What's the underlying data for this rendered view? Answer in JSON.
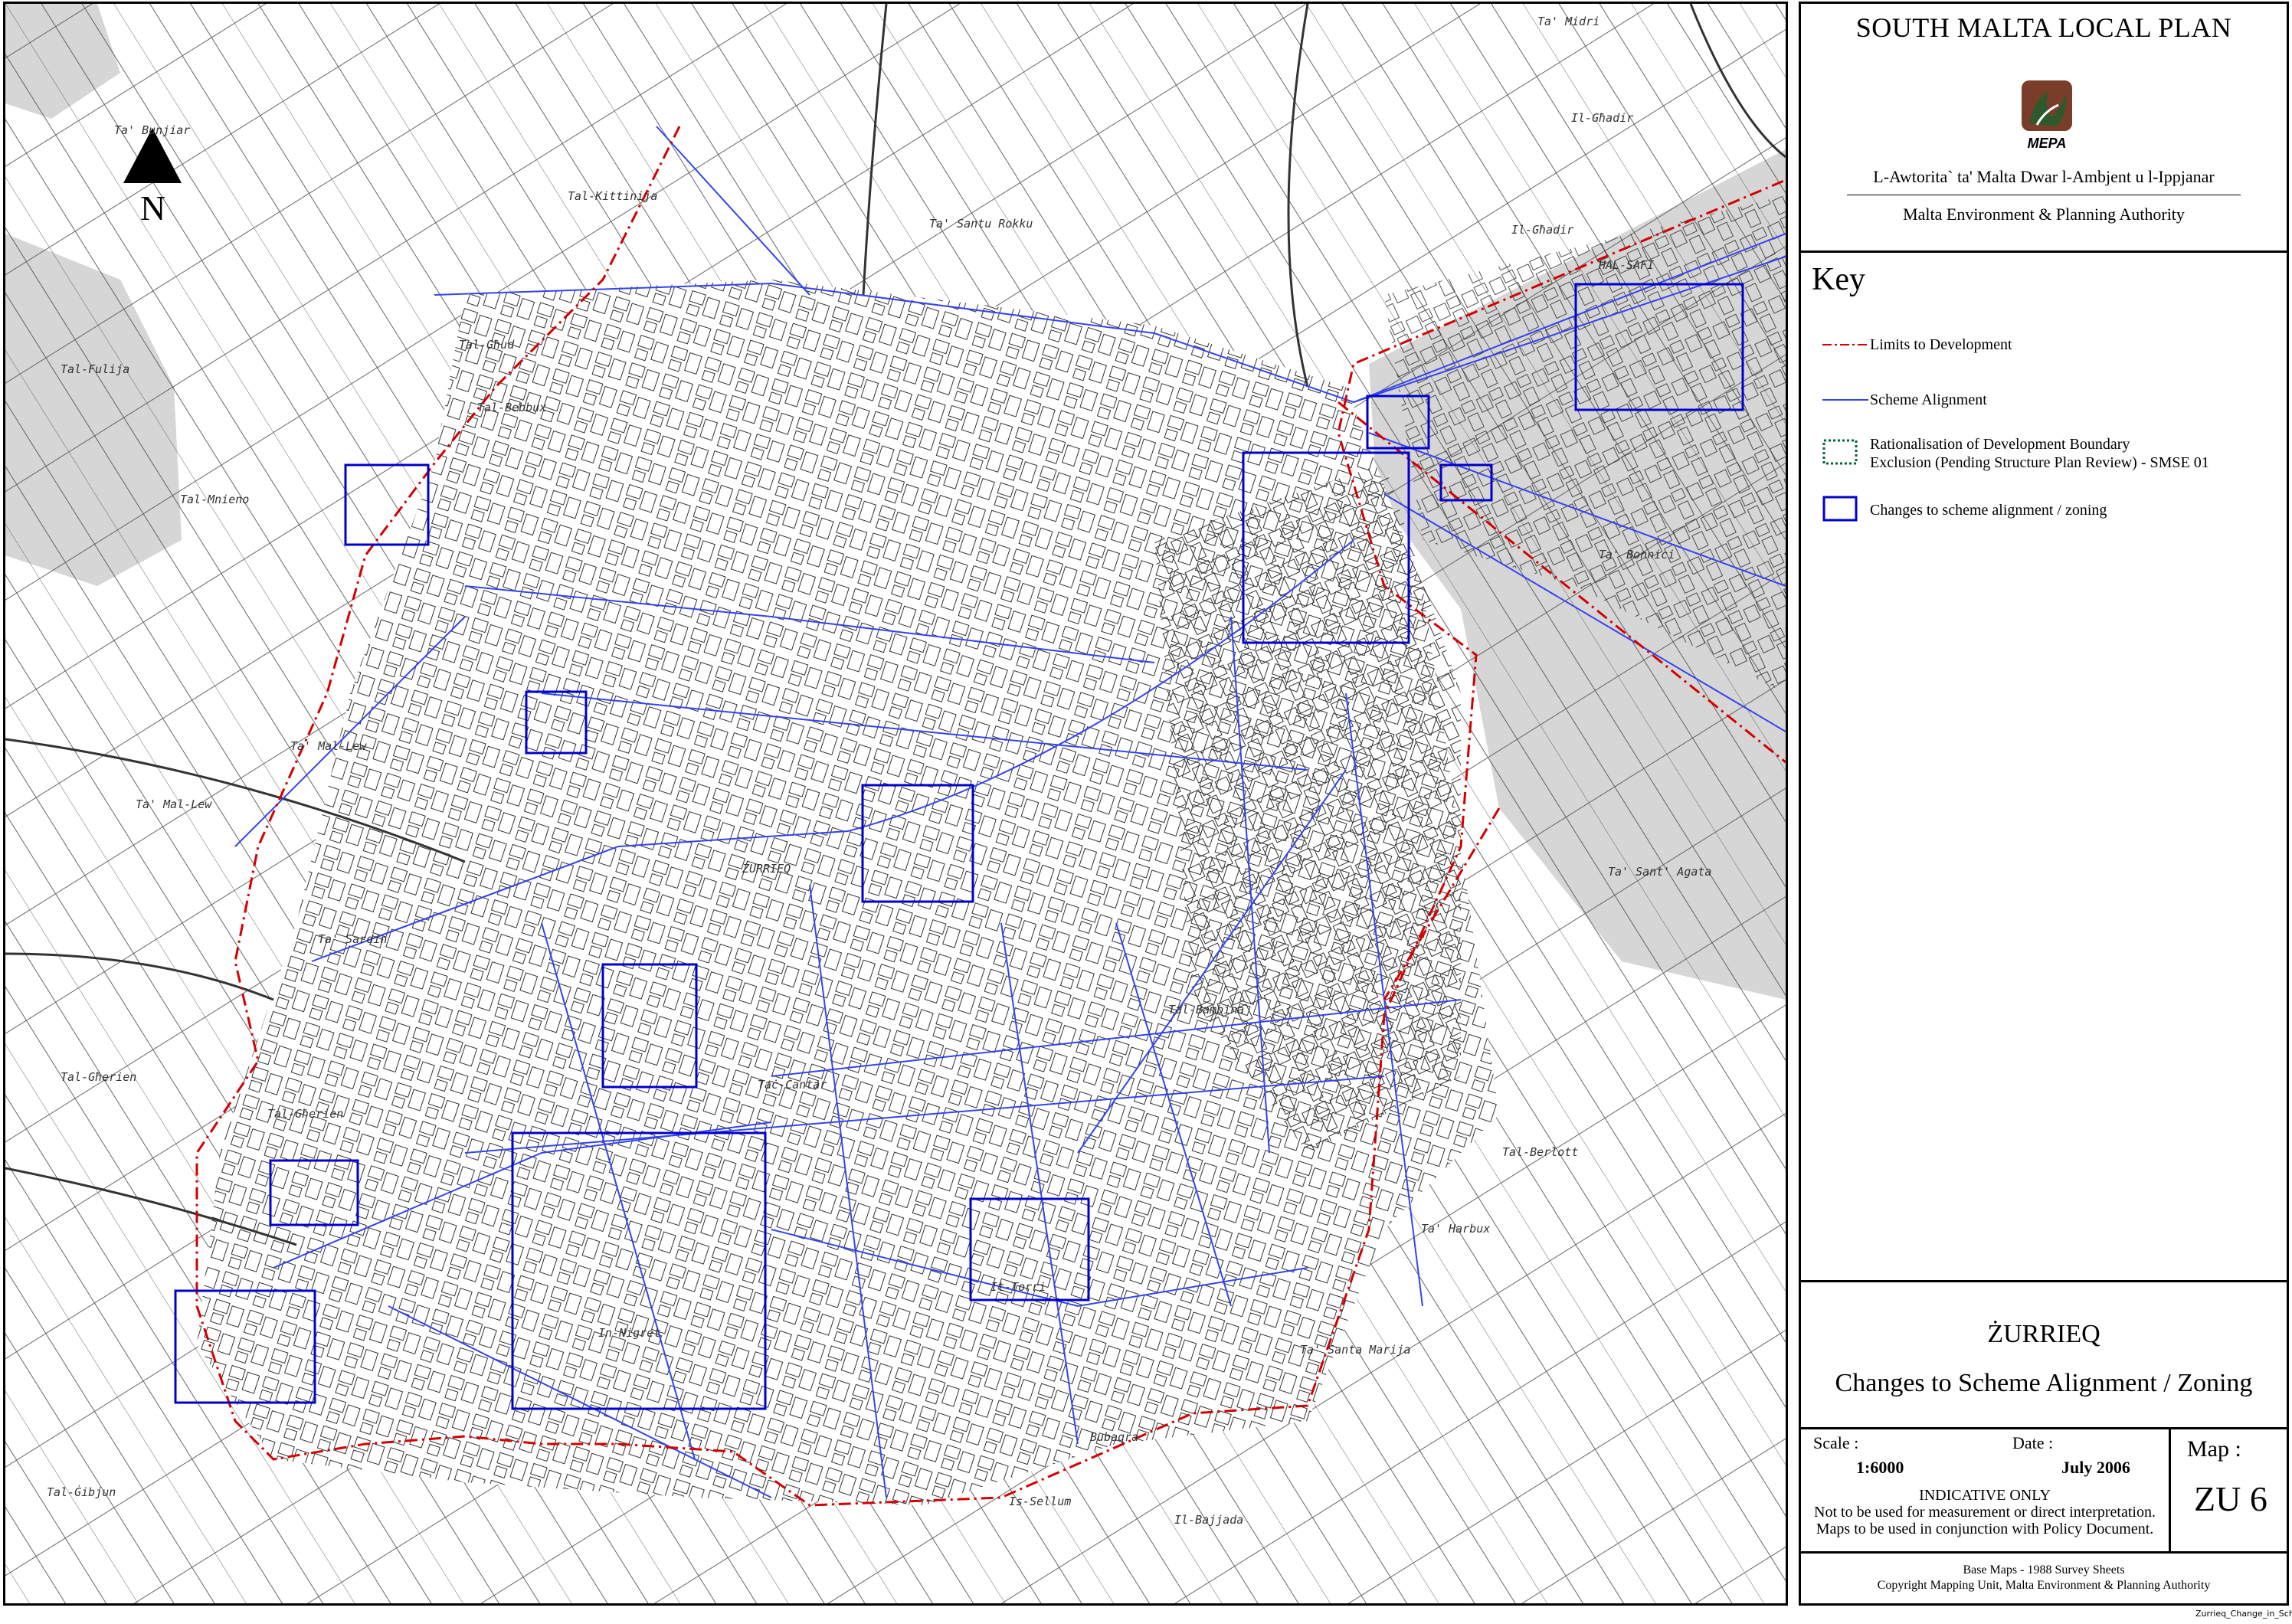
{
  "header": {
    "title": "SOUTH MALTA LOCAL PLAN",
    "logo_text": "MEPA",
    "authority_mt": "L-Awtorita` ta' Malta Dwar l-Ambjent u l-Ippjanar",
    "authority_en": "Malta Environment & Planning Authority"
  },
  "key": {
    "title": "Key",
    "items": [
      {
        "label": "Limits to Development",
        "color": "#d40000",
        "icon": "dash-dot-line"
      },
      {
        "label": "Scheme Alignment",
        "color": "#3344ee",
        "icon": "solid-line"
      },
      {
        "label": "Rationalisation of Development Boundary",
        "label2": "Exclusion (Pending Structure Plan Review) - SMSE 01",
        "color": "#006633",
        "icon": "dotted-box"
      },
      {
        "label": "Changes to scheme alignment / zoning",
        "color": "#0000cc",
        "icon": "blue-box"
      }
    ]
  },
  "map_title": {
    "locality": "ŻURRIEQ",
    "subtitle": "Changes to Scheme Alignment / Zoning"
  },
  "info": {
    "scale_label": "Scale :",
    "scale_value": "1:6000",
    "date_label": "Date :",
    "date_value": "July 2006",
    "map_label": "Map :",
    "map_value": "ZU 6",
    "indicative": "INDICATIVE ONLY",
    "note1": "Not to be used for measurement or direct interpretation.",
    "note2": "Maps to be used in conjunction with Policy Document."
  },
  "footer": {
    "line1": "Base Maps - 1988 Survey Sheets",
    "line2": "Copyright Mapping Unit, Malta Environment & Planning Authority"
  },
  "north": {
    "letter": "N"
  },
  "place_names": {
    "ta_bunjiar": "Ta' Bunjiar",
    "tal_kittinija": "Tal-Kittinija",
    "tal_ghud": "Tal-Għud",
    "tal_fulija": "Tal-Fulija",
    "tal_bebbux": "Tal-Bebbux",
    "tal_mnieno": "Tal-Mnieno",
    "ta_mal_lew1": "Ta' Mal-Lew",
    "ta_mal_lew2": "Ta' Mal-Lew",
    "ta_santu_rokku": "Ta' Santu Rokku",
    "ta_midri": "Ta' Midri",
    "il_ghadir1": "Il-Għadir",
    "il_ghadir2": "Il-Għadir",
    "hal_safi": "ĦAL-SAFI",
    "ta_bonnici": "Ta' Bonnici",
    "ta_sant_agata": "Ta' Sant' Agata",
    "zurrieq": "ŻURRIEQ",
    "tal_bambina": "Tal-Bambina",
    "tac_cantar": "Taċ-Ċantar",
    "tal_gherien1": "Tal-Għerien",
    "tal_gherien2": "Tal-Għerien",
    "ta_sardin": "Ta' Sardin",
    "in_nigret": "In-Nigret",
    "it_torri": "It-Torri",
    "tal_berlott": "Tal-Berlott",
    "ta_harbux": "Ta' Harbux",
    "ta_santa_marija": "Ta' Santa Marija",
    "bubaqra": "Bubaqra",
    "is_sellum": "Is-Sellum",
    "il_bajjada": "Il-Bajjada",
    "tal_gibjun": "Tal-Ġibjun"
  },
  "colors": {
    "limits": "#d40000",
    "scheme": "#3344ee",
    "change_box": "#0000cc",
    "shaded": "#d6d6d6"
  },
  "file_name": "Zurrieq_Change_in_Scheme_Alignment_Map.wor"
}
